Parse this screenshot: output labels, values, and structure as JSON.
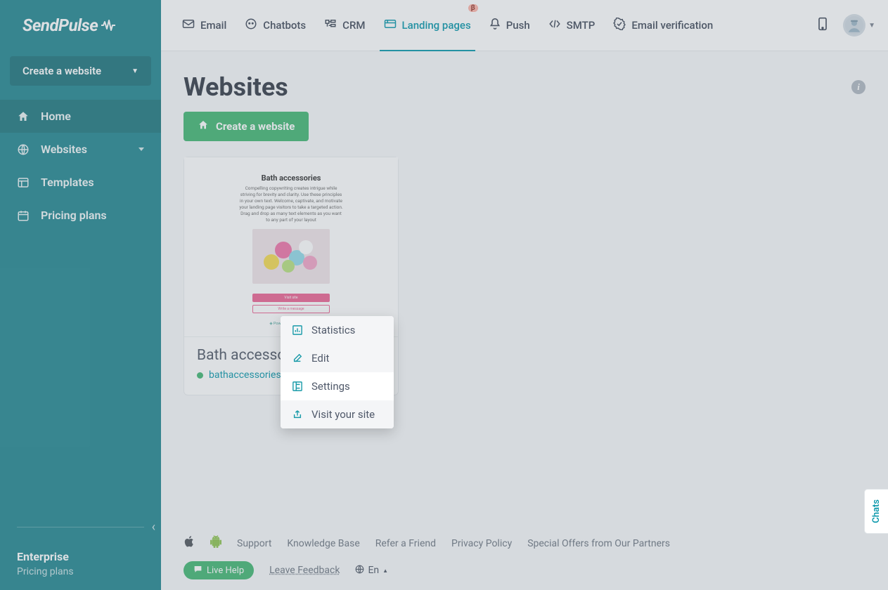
{
  "brand": "SendPulse",
  "sidebar": {
    "create_label": "Create a website",
    "items": [
      {
        "label": "Home",
        "icon": "home"
      },
      {
        "label": "Websites",
        "icon": "globe"
      },
      {
        "label": "Templates",
        "icon": "layout"
      },
      {
        "label": "Pricing plans",
        "icon": "calendar"
      }
    ],
    "plan": {
      "name": "Enterprise",
      "link": "Pricing plans"
    }
  },
  "topnav": {
    "items": [
      {
        "label": "Email",
        "icon": "mail"
      },
      {
        "label": "Chatbots",
        "icon": "chatbot"
      },
      {
        "label": "CRM",
        "icon": "crm"
      },
      {
        "label": "Landing pages",
        "icon": "landing",
        "active": true,
        "badge": "β"
      },
      {
        "label": "Push",
        "icon": "bell"
      },
      {
        "label": "SMTP",
        "icon": "code"
      },
      {
        "label": "Email verification",
        "icon": "check"
      }
    ]
  },
  "page": {
    "title": "Websites",
    "create_label": "Create a website"
  },
  "card": {
    "thumb_title": "Bath accessories",
    "thumb_desc": "Compelling copywriting creates intrigue while striving for brevity and clarity. Use these principles in your own text. Welcome, captivate, and motivate your landing page visitors to take a targeted action. Drag and drop as many text elements as you want to any part of your layout",
    "thumb_btn1": "Visit site",
    "thumb_btn2": "Write a message",
    "thumb_powered": "Powered by SendPulse",
    "title": "Bath accessories",
    "url": "bathaccessories"
  },
  "dropdown": {
    "items": [
      {
        "label": "Statistics",
        "icon": "stats"
      },
      {
        "label": "Edit",
        "icon": "edit"
      },
      {
        "label": "Settings",
        "icon": "settings",
        "highlight": true
      },
      {
        "label": "Visit your site",
        "icon": "share"
      }
    ]
  },
  "footer": {
    "links": [
      "Support",
      "Knowledge Base",
      "Refer a Friend",
      "Privacy Policy",
      "Special Offers from Our Partners"
    ],
    "live_help": "Live Help",
    "leave_feedback": "Leave Feedback",
    "lang": "En"
  },
  "chats_tab": "Chats"
}
